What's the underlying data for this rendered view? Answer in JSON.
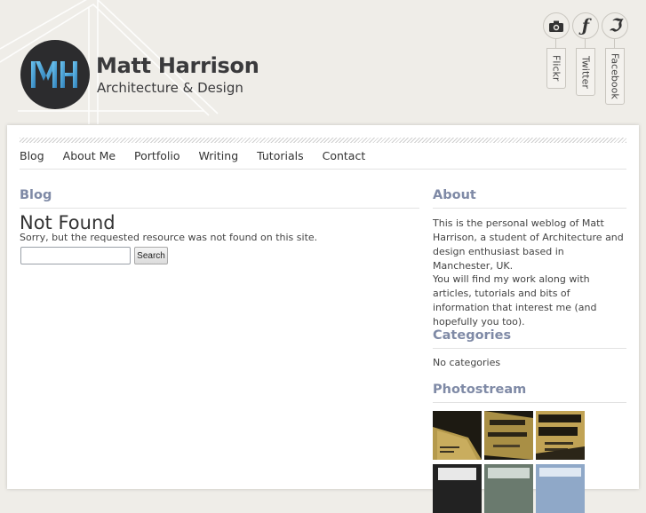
{
  "header": {
    "logo_letters": "MH",
    "title": "Matt Harrison",
    "tagline": "Architecture & Design"
  },
  "social": [
    {
      "name": "Flickr",
      "icon": "camera-icon",
      "glyph": "📷"
    },
    {
      "name": "Twitter",
      "icon": "twitter-icon",
      "glyph": "ƒ"
    },
    {
      "name": "Facebook",
      "icon": "facebook-icon",
      "glyph": "ℑ"
    }
  ],
  "nav": [
    "Blog",
    "About Me",
    "Portfolio",
    "Writing",
    "Tutorials",
    "Contact"
  ],
  "main": {
    "section_title": "Blog",
    "heading": "Not Found",
    "message": "Sorry, but the requested resource was not found on this site.",
    "search_button": "Search",
    "search_value": ""
  },
  "sidebar": {
    "about_title": "About",
    "about_p1": "This is the personal weblog of Matt Harrison, a student of Architecture and design enthusiast based in Manchester, UK.",
    "about_p2": "You will find my work along with articles, tutorials and bits of information that interest me (and hopefully you too).",
    "categories_title": "Categories",
    "categories_text": "No categories",
    "photostream_title": "Photostream"
  },
  "colors": {
    "background": "#efede8",
    "heading_accent": "#7f8aa6",
    "logo_dark": "#2c2c2e",
    "logo_blue": "#4aa3d8"
  }
}
